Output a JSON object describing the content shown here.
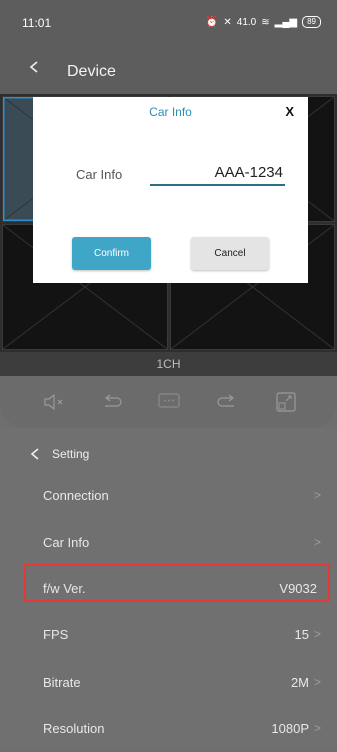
{
  "status_bar": {
    "time": "11:01",
    "network_speed": "41.0",
    "battery": "89"
  },
  "header": {
    "title": "Device"
  },
  "video": {
    "channel_label": "1CH"
  },
  "toolbar": {
    "icons": [
      "mute-icon",
      "undo-icon",
      "chat-icon",
      "redo-icon",
      "fullscreen-icon"
    ]
  },
  "settings": {
    "header_label": "Setting",
    "rows": [
      {
        "label": "Connection",
        "value": ""
      },
      {
        "label": "Car Info",
        "value": ""
      },
      {
        "label": "f/w Ver.",
        "value": "V9032"
      },
      {
        "label": "FPS",
        "value": "15"
      },
      {
        "label": "Bitrate",
        "value": "2M"
      },
      {
        "label": "Resolution",
        "value": "1080P"
      }
    ]
  },
  "dialog": {
    "title": "Car Info",
    "close_label": "X",
    "field_label": "Car Info",
    "field_value": "AAA-1234",
    "confirm_label": "Confirm",
    "cancel_label": "Cancel"
  },
  "colors": {
    "accent": "#3fa6c7",
    "highlight": "#e53935"
  }
}
